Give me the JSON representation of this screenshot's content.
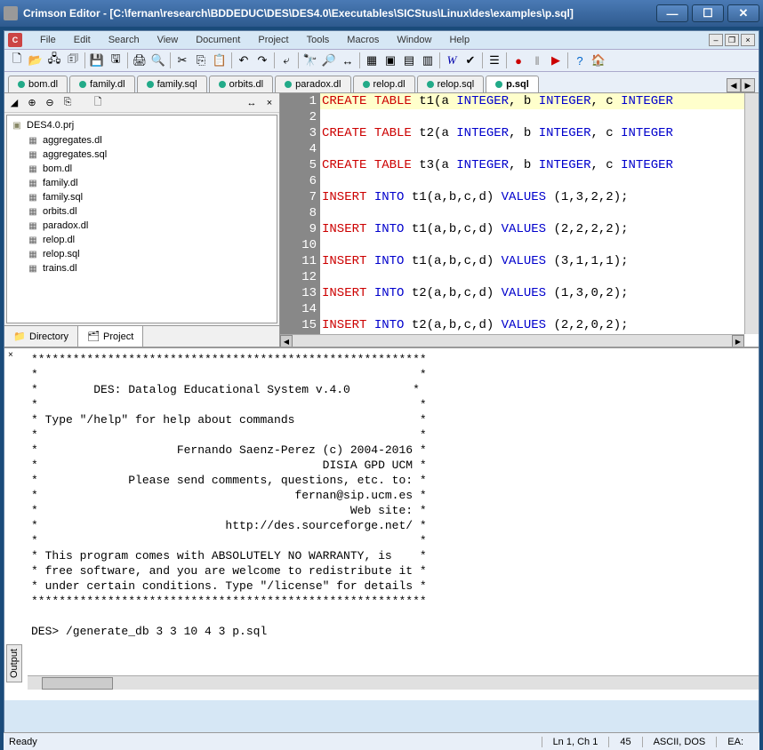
{
  "window": {
    "title": "Crimson Editor - [C:\\fernan\\research\\BDDEDUC\\DES\\DES4.0\\Executables\\SICStus\\Linux\\des\\examples\\p.sql]"
  },
  "menu": {
    "items": [
      "File",
      "Edit",
      "Search",
      "View",
      "Document",
      "Project",
      "Tools",
      "Macros",
      "Window",
      "Help"
    ]
  },
  "tabs": {
    "items": [
      "bom.dl",
      "family.dl",
      "family.sql",
      "orbits.dl",
      "paradox.dl",
      "relop.dl",
      "relop.sql",
      "p.sql"
    ],
    "active": 7
  },
  "sidebar": {
    "project": "DES4.0.prj",
    "files": [
      "aggregates.dl",
      "aggregates.sql",
      "bom.dl",
      "family.dl",
      "family.sql",
      "orbits.dl",
      "paradox.dl",
      "relop.dl",
      "relop.sql",
      "trains.dl"
    ],
    "tabs": {
      "directory": "Directory",
      "project": "Project"
    }
  },
  "editor": {
    "lines": [
      {
        "n": 1,
        "hl": true,
        "tokens": [
          [
            "r",
            "CREATE"
          ],
          [
            "p",
            " "
          ],
          [
            "r",
            "TABLE"
          ],
          [
            "p",
            " t1(a "
          ],
          [
            "b",
            "INTEGER"
          ],
          [
            "p",
            ", b "
          ],
          [
            "b",
            "INTEGER"
          ],
          [
            "p",
            ", c "
          ],
          [
            "b",
            "INTEGER"
          ]
        ]
      },
      {
        "n": 2,
        "tokens": []
      },
      {
        "n": 3,
        "tokens": [
          [
            "r",
            "CREATE"
          ],
          [
            "p",
            " "
          ],
          [
            "r",
            "TABLE"
          ],
          [
            "p",
            " t2(a "
          ],
          [
            "b",
            "INTEGER"
          ],
          [
            "p",
            ", b "
          ],
          [
            "b",
            "INTEGER"
          ],
          [
            "p",
            ", c "
          ],
          [
            "b",
            "INTEGER"
          ]
        ]
      },
      {
        "n": 4,
        "tokens": []
      },
      {
        "n": 5,
        "tokens": [
          [
            "r",
            "CREATE"
          ],
          [
            "p",
            " "
          ],
          [
            "r",
            "TABLE"
          ],
          [
            "p",
            " t3(a "
          ],
          [
            "b",
            "INTEGER"
          ],
          [
            "p",
            ", b "
          ],
          [
            "b",
            "INTEGER"
          ],
          [
            "p",
            ", c "
          ],
          [
            "b",
            "INTEGER"
          ]
        ]
      },
      {
        "n": 6,
        "tokens": []
      },
      {
        "n": 7,
        "tokens": [
          [
            "r",
            "INSERT"
          ],
          [
            "p",
            " "
          ],
          [
            "b",
            "INTO"
          ],
          [
            "p",
            " t1(a,b,c,d) "
          ],
          [
            "b",
            "VALUES"
          ],
          [
            "p",
            " (1,3,2,2);"
          ]
        ]
      },
      {
        "n": 8,
        "tokens": []
      },
      {
        "n": 9,
        "tokens": [
          [
            "r",
            "INSERT"
          ],
          [
            "p",
            " "
          ],
          [
            "b",
            "INTO"
          ],
          [
            "p",
            " t1(a,b,c,d) "
          ],
          [
            "b",
            "VALUES"
          ],
          [
            "p",
            " (2,2,2,2);"
          ]
        ]
      },
      {
        "n": 10,
        "tokens": []
      },
      {
        "n": 11,
        "tokens": [
          [
            "r",
            "INSERT"
          ],
          [
            "p",
            " "
          ],
          [
            "b",
            "INTO"
          ],
          [
            "p",
            " t1(a,b,c,d) "
          ],
          [
            "b",
            "VALUES"
          ],
          [
            "p",
            " (3,1,1,1);"
          ]
        ]
      },
      {
        "n": 12,
        "tokens": []
      },
      {
        "n": 13,
        "tokens": [
          [
            "r",
            "INSERT"
          ],
          [
            "p",
            " "
          ],
          [
            "b",
            "INTO"
          ],
          [
            "p",
            " t2(a,b,c,d) "
          ],
          [
            "b",
            "VALUES"
          ],
          [
            "p",
            " (1,3,0,2);"
          ]
        ]
      },
      {
        "n": 14,
        "tokens": []
      },
      {
        "n": 15,
        "tokens": [
          [
            "r",
            "INSERT"
          ],
          [
            "p",
            " "
          ],
          [
            "b",
            "INTO"
          ],
          [
            "p",
            " t2(a,b,c,d) "
          ],
          [
            "b",
            "VALUES"
          ],
          [
            "p",
            " (2,2,0,2);"
          ]
        ]
      }
    ]
  },
  "output": {
    "label": "Output",
    "text": "*********************************************************\n*                                                       *\n*        DES: Datalog Educational System v.4.0         *\n*                                                       *\n* Type \"/help\" for help about commands                  *\n*                                                       *\n*                    Fernando Saenz-Perez (c) 2004-2016 *\n*                                         DISIA GPD UCM *\n*             Please send comments, questions, etc. to: *\n*                                     fernan@sip.ucm.es *\n*                                             Web site: *\n*                           http://des.sourceforge.net/ *\n*                                                       *\n* This program comes with ABSOLUTELY NO WARRANTY, is    *\n* free software, and you are welcome to redistribute it *\n* under certain conditions. Type \"/license\" for details *\n*********************************************************\n\nDES> /generate_db 3 3 10 4 3 p.sql"
  },
  "status": {
    "main": "Ready",
    "pos": "Ln 1, Ch 1",
    "count": "45",
    "enc": "ASCII, DOS",
    "mode": "EA:"
  }
}
